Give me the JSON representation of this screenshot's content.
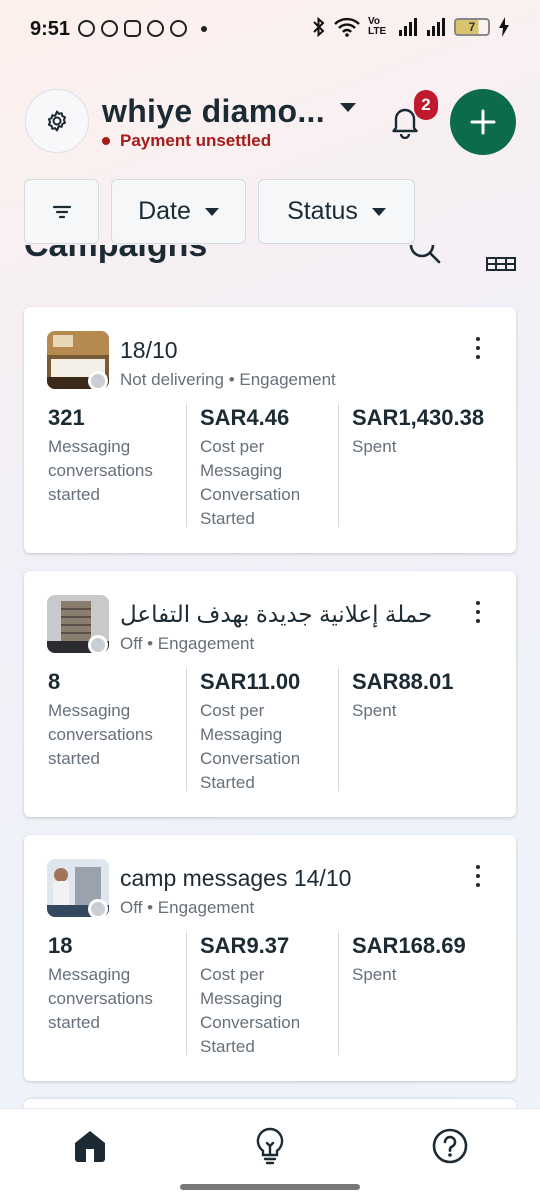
{
  "status_bar": {
    "time": "9:51",
    "network_label": "Vo LTE",
    "battery": "7"
  },
  "header": {
    "account_name": "whiye diamo...",
    "account_status": "Payment unsettled",
    "notification_count": "2"
  },
  "filters": {
    "date_label": "Date",
    "status_label": "Status"
  },
  "section": {
    "title": "Campaigns"
  },
  "campaigns": [
    {
      "name": "18/10",
      "status": "Not delivering",
      "objective": "Engagement",
      "metrics": [
        {
          "value": "321",
          "label": "Messaging conversations started"
        },
        {
          "value": "SAR4.46",
          "label": "Cost per Messaging Conversation Started"
        },
        {
          "value": "SAR1,430.38",
          "label": "Spent"
        }
      ]
    },
    {
      "name": "حملة إعلانية جديدة بهدف التفاعل",
      "status": "Off",
      "objective": "Engagement",
      "metrics": [
        {
          "value": "8",
          "label": "Messaging conversations started"
        },
        {
          "value": "SAR11.00",
          "label": "Cost per Messaging Conversation Started"
        },
        {
          "value": "SAR88.01",
          "label": "Spent"
        }
      ]
    },
    {
      "name": "camp messages 14/10",
      "status": "Off",
      "objective": "Engagement",
      "metrics": [
        {
          "value": "18",
          "label": "Messaging conversations started"
        },
        {
          "value": "SAR9.37",
          "label": "Cost per Messaging Conversation Started"
        },
        {
          "value": "SAR168.69",
          "label": "Spent"
        }
      ]
    }
  ],
  "separator": "•",
  "colors": {
    "brand_green": "#0b6b4c",
    "alert_red": "#a61b1b",
    "badge_red": "#c0182c",
    "text_primary": "#1c2b33",
    "text_secondary": "#65707a"
  },
  "bottom_nav": [
    {
      "icon": "home-icon",
      "active": true
    },
    {
      "icon": "lightbulb-icon",
      "active": false
    },
    {
      "icon": "help-icon",
      "active": false
    }
  ]
}
